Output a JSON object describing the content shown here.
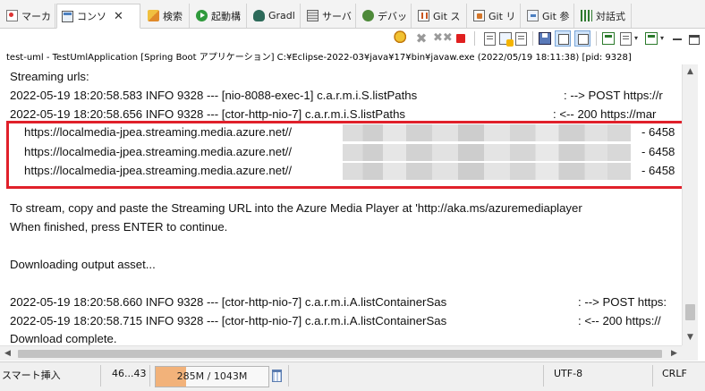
{
  "tabs": [
    {
      "label": "マーカ",
      "icon": "markers-icon",
      "active": false
    },
    {
      "label": "コンソ",
      "icon": "console-icon",
      "active": true
    },
    {
      "label": "検索",
      "icon": "search-icon",
      "active": false
    },
    {
      "label": "起動構",
      "icon": "run-config-icon",
      "active": false
    },
    {
      "label": "Gradl",
      "icon": "gradle-icon",
      "active": false
    },
    {
      "label": "サーバ",
      "icon": "servers-icon",
      "active": false
    },
    {
      "label": "デバッ",
      "icon": "debug-icon",
      "active": false
    },
    {
      "label": "Git ス",
      "icon": "git-staging-icon",
      "active": false
    },
    {
      "label": "Git リ",
      "icon": "git-repo-icon",
      "active": false
    },
    {
      "label": "Git 参",
      "icon": "git-reflog-icon",
      "active": false
    },
    {
      "label": "対話式",
      "icon": "interactive-icon",
      "active": false
    }
  ],
  "tab_close_glyph": "✕",
  "toolbar": {
    "menu_arrow": "▾"
  },
  "process_header": "test-uml - TestUmlApplication [Spring Boot アプリケーション] C:¥Eclipse-2022-03¥java¥17¥bin¥javaw.exe  (2022/05/19 18:11:38) [pid: 9328]",
  "console": {
    "lines": [
      {
        "text": "Streaming urls:"
      },
      {
        "text": "2022-05-19 18:20:58.583  INFO 9328 --- [nio-8088-exec-1] c.a.r.m.i.S.listPaths",
        "msg": ": --> POST https://r"
      },
      {
        "text": "2022-05-19 18:20:58.656  INFO 9328 --- [ctor-http-nio-7] c.a.r.m.i.S.listPaths",
        "msg": ": <-- 200 https://mar"
      },
      {
        "text": "https://localmedia-jpea.streaming.media.azure.net//",
        "suffix": "- 6458"
      },
      {
        "text": "https://localmedia-jpea.streaming.media.azure.net//",
        "suffix": "- 6458"
      },
      {
        "text": "https://localmedia-jpea.streaming.media.azure.net//",
        "suffix": "- 6458"
      },
      {
        "text": "To stream, copy and paste the Streaming URL into the Azure Media Player at 'http://aka.ms/azuremediaplayer"
      },
      {
        "text": "When finished, press ENTER to continue."
      },
      {
        "text": "Downloading output asset..."
      },
      {
        "text": "2022-05-19 18:20:58.660  INFO 9328 --- [ctor-http-nio-7] c.a.r.m.i.A.listContainerSas",
        "msg": ": --> POST https:"
      },
      {
        "text": "2022-05-19 18:20:58.715  INFO 9328 --- [ctor-http-nio-7] c.a.r.m.i.A.listContainerSas",
        "msg": ": <-- 200 https://"
      },
      {
        "text": "Download complete."
      }
    ]
  },
  "scrollbar": {
    "up": "▲",
    "down": "▼",
    "left": "◀",
    "right": "▶"
  },
  "statusbar": {
    "insert_mode": "スマート挿入",
    "position": "46...43",
    "heap_used": "285M",
    "heap_total": "1043M",
    "heap_label": "285M / 1043M",
    "heap_fraction": 0.273,
    "encoding": "UTF-8",
    "line_delimiter": "CRLF"
  },
  "colors": {
    "highlight_border": "#e0202a",
    "heap_fill": "#f2b27a"
  }
}
